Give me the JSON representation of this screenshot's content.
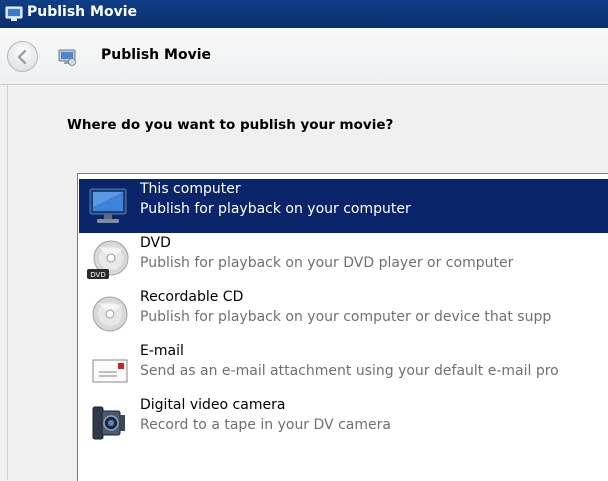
{
  "window": {
    "title": "Publish Movie"
  },
  "nav": {
    "title": "Publish Movie"
  },
  "question": "Where do you want to publish your movie?",
  "options": [
    {
      "title": "This computer",
      "desc": "Publish for playback on your computer",
      "icon": "computer-icon",
      "selected": true
    },
    {
      "title": "DVD",
      "desc": "Publish for playback on your DVD player or computer",
      "icon": "dvd-icon",
      "selected": false
    },
    {
      "title": "Recordable CD",
      "desc": "Publish for playback on your computer or device that supp",
      "icon": "cd-icon",
      "selected": false
    },
    {
      "title": "E-mail",
      "desc": "Send as an e-mail attachment using your default e-mail pro",
      "icon": "email-icon",
      "selected": false
    },
    {
      "title": "Digital video camera",
      "desc": "Record to a tape in your DV camera",
      "icon": "camcorder-icon",
      "selected": false
    }
  ],
  "colors": {
    "selection": "#0a246a",
    "titlebar": "#0f3f87",
    "secondary_text": "#707070"
  }
}
